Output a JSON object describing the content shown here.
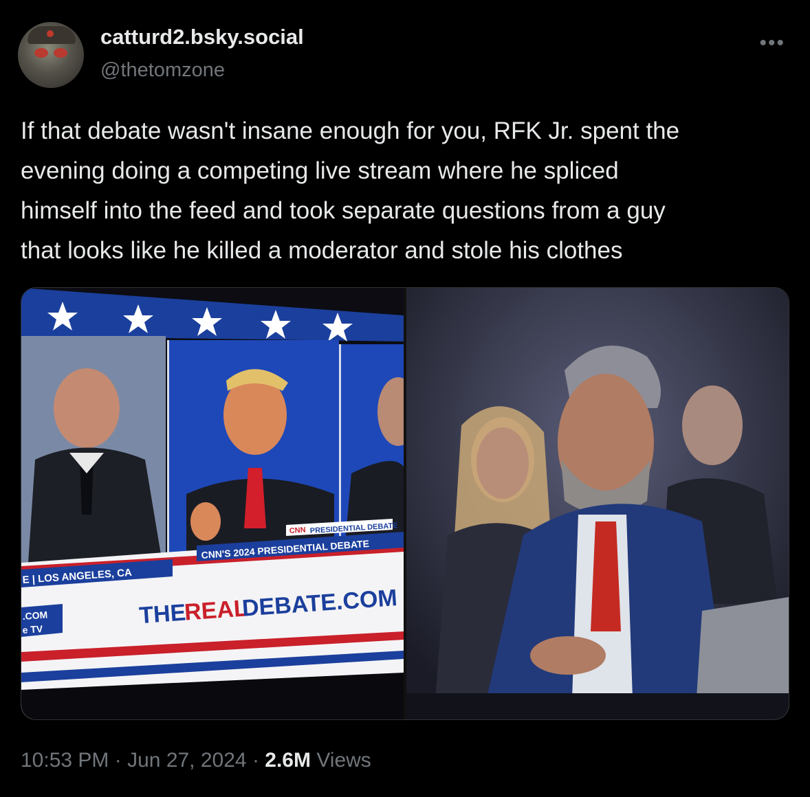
{
  "author": {
    "display_name": "catturd2.bsky.social",
    "handle": "@thetomzone"
  },
  "more_icon": "more-horizontal-icon",
  "tweet": {
    "text": "If that debate wasn't insane enough for you, RFK Jr. spent the\nevening doing a competing live stream where he spliced\nhimself into the feed and took separate questions from a guy\nthat looks like he killed a moderator and stole his clothes"
  },
  "media": {
    "left_overlay": {
      "network_label": "CNN",
      "presidential_debate": "PRESIDENTIAL DEBATE",
      "chyron": "CNN'S 2024 PRESIDENTIAL DEBATE",
      "location": "E | LOS ANGELES, CA",
      "site_the": "THE",
      "site_real": "REAL",
      "site_debate": "DEBATE.COM",
      "side_com": ".COM",
      "side_tv": "e TV"
    }
  },
  "meta": {
    "time": "10:53 PM",
    "separator": "·",
    "date": "Jun 27, 2024",
    "views_count": "2.6M",
    "views_label": "Views"
  }
}
